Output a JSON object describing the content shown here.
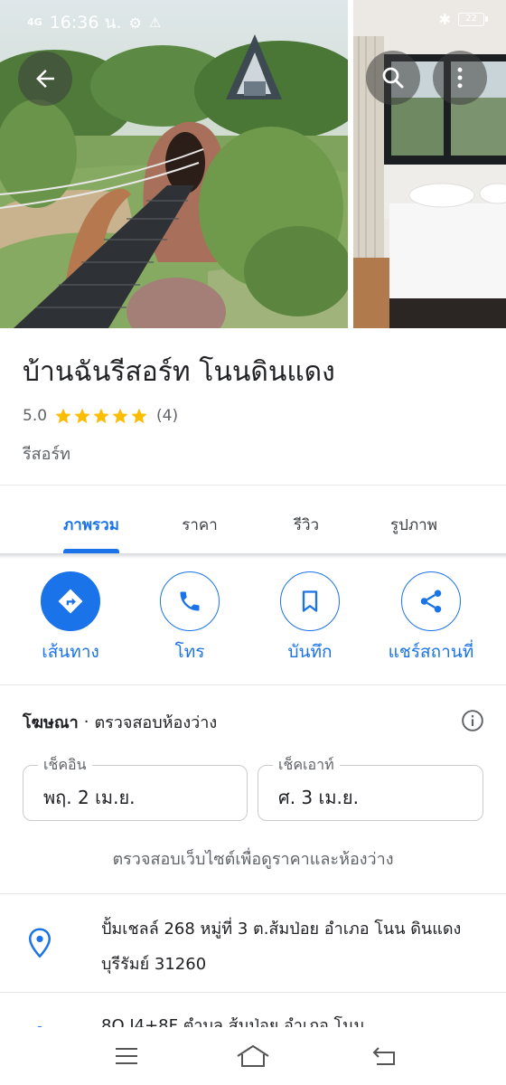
{
  "status_bar": {
    "network": "4G",
    "time": "16:36 น.",
    "battery": "22"
  },
  "icons": {
    "back": "arrow-left-icon",
    "search": "search-icon",
    "more": "more-vertical-icon",
    "info": "info-icon",
    "pin": "location-pin-icon"
  },
  "place": {
    "name": "บ้านฉันรีสอร์ท โนนดินแดง",
    "rating": "5.0",
    "stars": 5,
    "review_count": "(4)",
    "category": "รีสอร์ท"
  },
  "tabs": [
    {
      "label": "ภาพรวม",
      "active": true
    },
    {
      "label": "ราคา",
      "active": false
    },
    {
      "label": "รีวิว",
      "active": false
    },
    {
      "label": "รูปภาพ",
      "active": false
    }
  ],
  "actions": [
    {
      "label": "เส้นทาง",
      "icon": "directions-icon"
    },
    {
      "label": "โทร",
      "icon": "phone-icon"
    },
    {
      "label": "บันทึก",
      "icon": "bookmark-icon"
    },
    {
      "label": "แชร์สถานที่",
      "icon": "share-icon"
    }
  ],
  "ad": {
    "tag": "โฆษณา",
    "separator": "·",
    "text": "ตรวจสอบห้องว่าง",
    "checkin_label": "เช็คอิน",
    "checkin_value": "พฤ. 2 เม.ย.",
    "checkout_label": "เช็คเอาท์",
    "checkout_value": "ศ. 3 เม.ย.",
    "site_prompt": "ตรวจสอบเว็บไซต์เพื่อดูราคาและห้องว่าง"
  },
  "address": {
    "line": "ปั้มเชลล์ 268 หมู่ที่ 3 ต.ส้มป่อย อำเภอ โนน ดินแดง บุรีรัมย์ 31260",
    "plus_code": "8Q J4+8F ตำบล ส้มป่อย อำเภอ โนน"
  },
  "colors": {
    "accent": "#1a73e8",
    "star": "#fbbc04",
    "text_secondary": "#5f6368"
  }
}
